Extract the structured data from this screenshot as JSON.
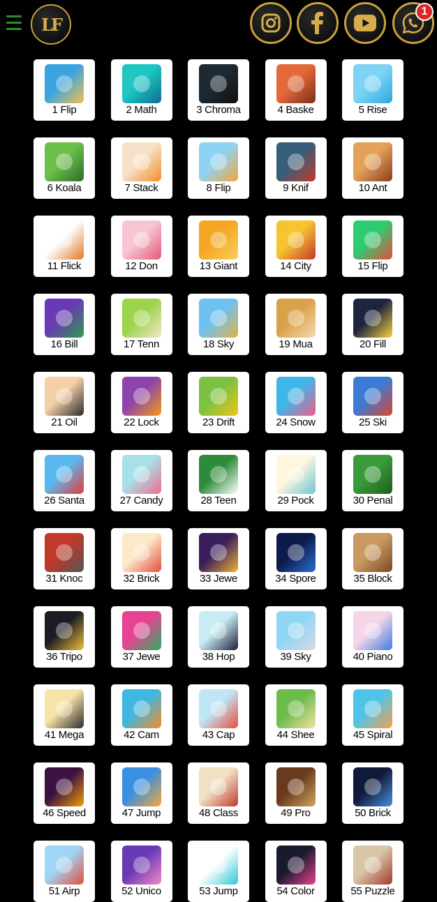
{
  "header": {
    "logo_text": "LF",
    "social": [
      {
        "name": "instagram",
        "icon": "instagram-icon"
      },
      {
        "name": "facebook",
        "icon": "facebook-icon"
      },
      {
        "name": "youtube",
        "icon": "youtube-icon"
      },
      {
        "name": "whatsapp",
        "icon": "whatsapp-icon",
        "badge": "1"
      }
    ]
  },
  "games": [
    {
      "label": "1 Flip",
      "c1": "#3aa3e0",
      "c2": "#f2c24b"
    },
    {
      "label": "2 Math",
      "c1": "#1ec7c2",
      "c2": "#0b6e8f"
    },
    {
      "label": "3 Chroma",
      "c1": "#1d2a33",
      "c2": "#111"
    },
    {
      "label": "4 Baske",
      "c1": "#e56a3a",
      "c2": "#7a2e1c"
    },
    {
      "label": "5 Rise",
      "c1": "#7fd4f5",
      "c2": "#2ea7e0"
    },
    {
      "label": "6 Koala",
      "c1": "#6cc04a",
      "c2": "#2e6b2a"
    },
    {
      "label": "7 Stack",
      "c1": "#f7e1c8",
      "c2": "#f28c28"
    },
    {
      "label": "8 Flip",
      "c1": "#8fd3f4",
      "c2": "#f2a73b"
    },
    {
      "label": "9 Knif",
      "c1": "#355f7a",
      "c2": "#c23a2a"
    },
    {
      "label": "10 Ant",
      "c1": "#e3a15a",
      "c2": "#8a3b1c"
    },
    {
      "label": "11 Flick",
      "c1": "#ffffff",
      "c2": "#e07a2a"
    },
    {
      "label": "12 Don",
      "c1": "#f7c6d1",
      "c2": "#e35a7a"
    },
    {
      "label": "13 Giant",
      "c1": "#f5a623",
      "c2": "#f7d05a"
    },
    {
      "label": "14 City",
      "c1": "#f7c431",
      "c2": "#c0392b"
    },
    {
      "label": "15 Flip",
      "c1": "#2ecc71",
      "c2": "#e74c3c"
    },
    {
      "label": "16 Bill",
      "c1": "#6a3ab5",
      "c2": "#2e9b4a"
    },
    {
      "label": "17 Tenn",
      "c1": "#9bd34a",
      "c2": "#f2e6c8"
    },
    {
      "label": "18 Sky",
      "c1": "#6ec1f0",
      "c2": "#e2b24a"
    },
    {
      "label": "19 Mua",
      "c1": "#d9a24a",
      "c2": "#f7d9b0"
    },
    {
      "label": "20 Fill",
      "c1": "#1d2440",
      "c2": "#f7d23a"
    },
    {
      "label": "21 Oil",
      "c1": "#f4d0a8",
      "c2": "#2a2a2a"
    },
    {
      "label": "22 Lock",
      "c1": "#8e44ad",
      "c2": "#f39c12"
    },
    {
      "label": "23 Drift",
      "c1": "#7cc242",
      "c2": "#f2c31b"
    },
    {
      "label": "24 Snow",
      "c1": "#3fb6e8",
      "c2": "#f25a8a"
    },
    {
      "label": "25 Ski",
      "c1": "#3a7bd5",
      "c2": "#d9482b"
    },
    {
      "label": "26 Santa",
      "c1": "#5ab8f0",
      "c2": "#e53935"
    },
    {
      "label": "27 Candy",
      "c1": "#a8e0e8",
      "c2": "#f26a8d"
    },
    {
      "label": "28 Teen",
      "c1": "#2e8b3a",
      "c2": "#ffffff"
    },
    {
      "label": "29 Pock",
      "c1": "#fff6dd",
      "c2": "#6cc6d8"
    },
    {
      "label": "30 Penal",
      "c1": "#3a9b3a",
      "c2": "#1e5c1e"
    },
    {
      "label": "31 Knoc",
      "c1": "#c0392b",
      "c2": "#555555"
    },
    {
      "label": "32 Brick",
      "c1": "#fbe9c8",
      "c2": "#e74c3c"
    },
    {
      "label": "33 Jewe",
      "c1": "#3a1f5c",
      "c2": "#f2b233"
    },
    {
      "label": "34 Spore",
      "c1": "#0d1b4a",
      "c2": "#2a6fd6"
    },
    {
      "label": "35 Block",
      "c1": "#c89a62",
      "c2": "#7a4a22"
    },
    {
      "label": "36 Tripo",
      "c1": "#1c1c24",
      "c2": "#f2c23b"
    },
    {
      "label": "37 Jewe",
      "c1": "#e84393",
      "c2": "#27ae60"
    },
    {
      "label": "38 Hop",
      "c1": "#c8ecf5",
      "c2": "#1e1e3a"
    },
    {
      "label": "39 Sky",
      "c1": "#8fd6f4",
      "c2": "#d9d9e6"
    },
    {
      "label": "40 Piano",
      "c1": "#f5d6e8",
      "c2": "#3f7de0"
    },
    {
      "label": "41 Mega",
      "c1": "#f7e2a8",
      "c2": "#2b2b2b"
    },
    {
      "label": "42 Cam",
      "c1": "#3fb7e0",
      "c2": "#f28c28"
    },
    {
      "label": "43 Cap",
      "c1": "#bfe6f5",
      "c2": "#e74c3c"
    },
    {
      "label": "44 Shee",
      "c1": "#6dbb4a",
      "c2": "#f4e1a6"
    },
    {
      "label": "45 Spiral",
      "c1": "#4ec5e8",
      "c2": "#f5a04a"
    },
    {
      "label": "46 Speed",
      "c1": "#3b1240",
      "c2": "#f29f05"
    },
    {
      "label": "47 Jump",
      "c1": "#3a8fe0",
      "c2": "#f2a73b"
    },
    {
      "label": "48 Class",
      "c1": "#f0e0c4",
      "c2": "#c0392b"
    },
    {
      "label": "49 Pro",
      "c1": "#6a3a1e",
      "c2": "#d0a560"
    },
    {
      "label": "50 Brick",
      "c1": "#0f1a3a",
      "c2": "#4a8fe0"
    },
    {
      "label": "51 Airp",
      "c1": "#9fd6f5",
      "c2": "#e74c3c"
    },
    {
      "label": "52 Unico",
      "c1": "#6a3ab5",
      "c2": "#f58ac8"
    },
    {
      "label": "53 Jump",
      "c1": "#ffffff",
      "c2": "#2ec7d8"
    },
    {
      "label": "54 Color",
      "c1": "#1a1a2e",
      "c2": "#e84393"
    },
    {
      "label": "55 Puzzle",
      "c1": "#d8c6a8",
      "c2": "#a33a2a"
    }
  ]
}
